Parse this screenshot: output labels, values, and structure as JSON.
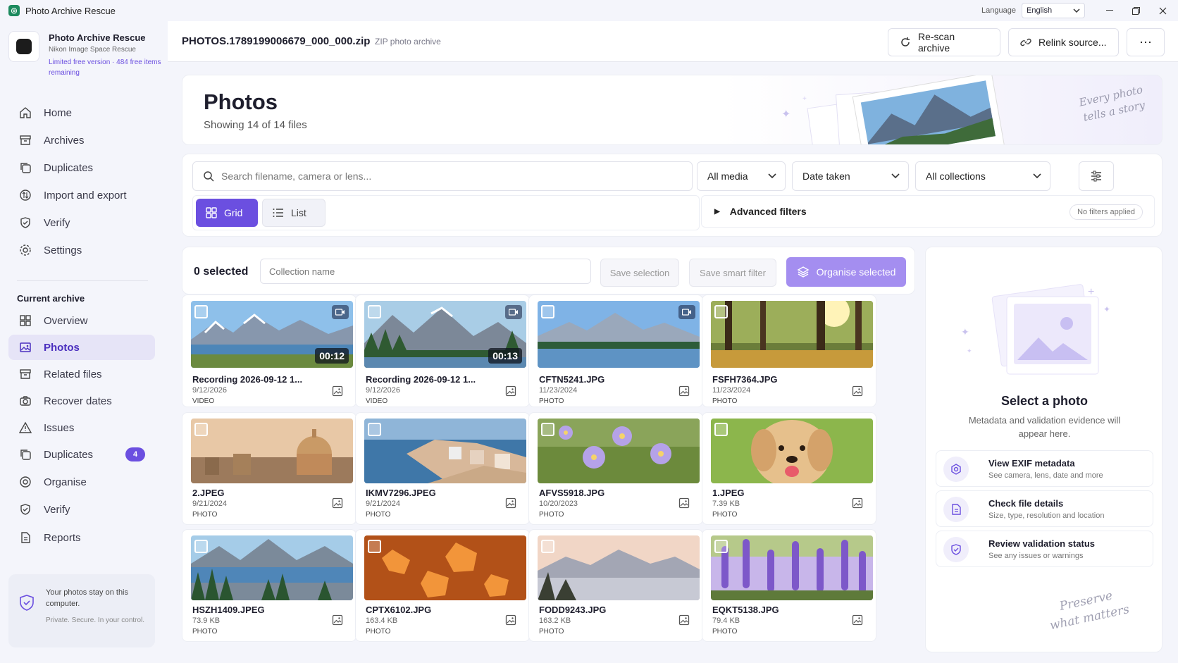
{
  "window": {
    "title": "Photo Archive Rescue",
    "language_label": "Language",
    "language_value": "English"
  },
  "sidebar": {
    "brand_title": "Photo Archive Rescue",
    "brand_subtitle": "Nikon Image Space Rescue",
    "brand_limit": "Limited free version · 484 free items remaining",
    "top_items": [
      {
        "label": "Home",
        "icon": "home-icon"
      },
      {
        "label": "Archives",
        "icon": "archive-icon"
      },
      {
        "label": "Duplicates",
        "icon": "copy-icon"
      },
      {
        "label": "Import and export",
        "icon": "import-export-icon"
      },
      {
        "label": "Verify",
        "icon": "shield-check-icon"
      },
      {
        "label": "Settings",
        "icon": "gear-icon"
      }
    ],
    "section_label": "Current archive",
    "archive_items": [
      {
        "label": "Overview",
        "icon": "grid-icon"
      },
      {
        "label": "Photos",
        "icon": "image-icon",
        "active": true
      },
      {
        "label": "Related files",
        "icon": "archive-icon"
      },
      {
        "label": "Recover dates",
        "icon": "camera-icon"
      },
      {
        "label": "Issues",
        "icon": "warning-icon"
      },
      {
        "label": "Duplicates",
        "icon": "copy-icon",
        "badge": "4"
      },
      {
        "label": "Organise",
        "icon": "organise-icon"
      },
      {
        "label": "Verify",
        "icon": "shield-check-icon"
      },
      {
        "label": "Reports",
        "icon": "report-icon"
      }
    ],
    "privacy_line1": "Your photos stay on this computer.",
    "privacy_line2": "Private. Secure. In your control."
  },
  "header": {
    "file_name": "PHOTOS.1789199006679_000_000.zip",
    "file_kind": "ZIP photo archive",
    "rescan_label": "Re-scan archive",
    "relink_label": "Relink source...",
    "more_label": "⋯"
  },
  "banner": {
    "title": "Photos",
    "subtitle": "Showing 14 of 14 files",
    "tagline": "Every photo tells a story"
  },
  "filters": {
    "search_placeholder": "Search filename, camera or lens...",
    "media_value": "All media",
    "date_value": "Date taken",
    "collection_value": "All collections",
    "view_grid_label": "Grid",
    "view_list_label": "List",
    "advanced_label": "Advanced filters",
    "no_filters_label": "No filters applied"
  },
  "selection": {
    "count_label": "0 selected",
    "collection_placeholder": "Collection name",
    "save_selection_label": "Save selection",
    "save_smart_label": "Save smart filter",
    "organise_label": "Organise selected"
  },
  "colors": {
    "accent": "#6b4fe0",
    "accent_light": "#a48ef0",
    "active_bg": "#e6e4f7"
  },
  "photos": [
    {
      "name": "Recording 2026-09-12 1...",
      "meta": "9/12/2026",
      "type": "VIDEO",
      "duration": "00:12",
      "video": true
    },
    {
      "name": "Recording 2026-09-12 1...",
      "meta": "9/12/2026",
      "type": "VIDEO",
      "duration": "00:13",
      "video": true
    },
    {
      "name": "CFTN5241.JPG",
      "meta": "11/23/2024",
      "type": "PHOTO",
      "video": true
    },
    {
      "name": "FSFH7364.JPG",
      "meta": "11/23/2024",
      "type": "PHOTO"
    },
    {
      "name": "2.JPEG",
      "meta": "9/21/2024",
      "type": "PHOTO"
    },
    {
      "name": "IKMV7296.JPEG",
      "meta": "9/21/2024",
      "type": "PHOTO"
    },
    {
      "name": "AFVS5918.JPG",
      "meta": "10/20/2023",
      "type": "PHOTO"
    },
    {
      "name": "1.JPEG",
      "meta": "7.39 KB",
      "type": "PHOTO"
    },
    {
      "name": "HSZH1409.JPEG",
      "meta": "73.9 KB",
      "type": "PHOTO"
    },
    {
      "name": "CPTX6102.JPG",
      "meta": "163.4 KB",
      "type": "PHOTO"
    },
    {
      "name": "FODD9243.JPG",
      "meta": "163.2 KB",
      "type": "PHOTO"
    },
    {
      "name": "EQKT5138.JPG",
      "meta": "79.4 KB",
      "type": "PHOTO"
    }
  ],
  "details": {
    "title": "Select a photo",
    "subtitle": "Metadata and validation evidence will appear here.",
    "items": [
      {
        "title": "View EXIF metadata",
        "sub": "See camera, lens, date and more"
      },
      {
        "title": "Check file details",
        "sub": "Size, type, resolution and location"
      },
      {
        "title": "Review validation status",
        "sub": "See any issues or warnings"
      }
    ],
    "signature": "Preserve what matters"
  }
}
